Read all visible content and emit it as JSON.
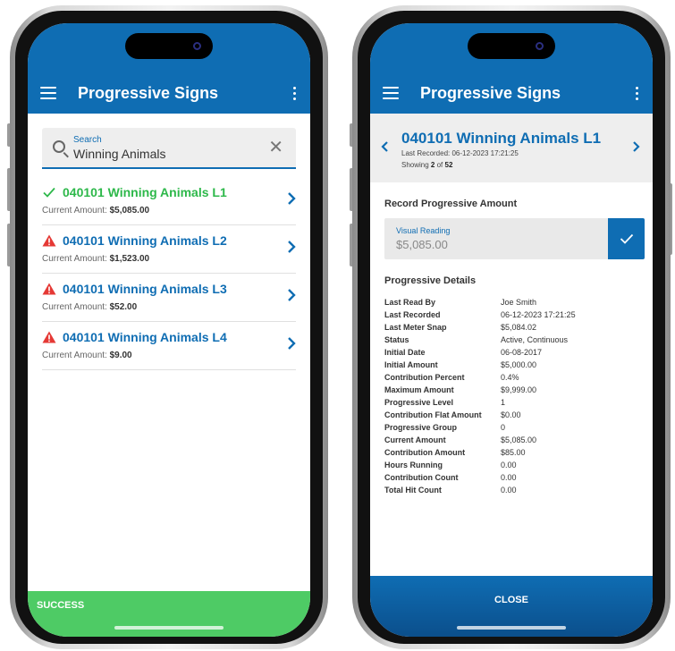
{
  "app": {
    "title": "Progressive Signs"
  },
  "colors": {
    "primary": "#0f6db3",
    "success": "#4ecb65",
    "success_text": "#2db84a",
    "warning": "#e53935"
  },
  "list_screen": {
    "search": {
      "label": "Search",
      "value": "Winning Animals"
    },
    "items": [
      {
        "title": "040101 Winning Animals L1",
        "amount_label": "Current Amount:",
        "amount": "$5,085.00",
        "status_icon": "check-icon"
      },
      {
        "title": "040101 Winning Animals L2",
        "amount_label": "Current Amount:",
        "amount": "$1,523.00",
        "status_icon": "warning-icon"
      },
      {
        "title": "040101 Winning Animals L3",
        "amount_label": "Current Amount:",
        "amount": "$52.00",
        "status_icon": "warning-icon"
      },
      {
        "title": "040101 Winning Animals L4",
        "amount_label": "Current Amount:",
        "amount": "$9.00",
        "status_icon": "warning-icon"
      }
    ],
    "footer": "SUCCESS"
  },
  "detail_screen": {
    "header": {
      "title": "040101 Winning Animals L1",
      "last_recorded": "Last Recorded: 06-12-2023 17:21:25",
      "showing_prefix": "Showing",
      "showing_index": "2",
      "showing_of": "of",
      "showing_total": "52"
    },
    "record_title": "Record Progressive Amount",
    "visual_reading": {
      "label": "Visual Reading",
      "value": "$5,085.00"
    },
    "details_title": "Progressive Details",
    "details": [
      {
        "key": "Last Read By",
        "value": "Joe Smith"
      },
      {
        "key": "Last Recorded",
        "value": "06-12-2023 17:21:25"
      },
      {
        "key": "Last Meter Snap",
        "value": "$5,084.02"
      },
      {
        "key": "Status",
        "value": "Active, Continuous"
      },
      {
        "key": "Initial Date",
        "value": "06-08-2017"
      },
      {
        "key": "Initial Amount",
        "value": "$5,000.00"
      },
      {
        "key": "Contribution Percent",
        "value": "0.4%"
      },
      {
        "key": "Maximum Amount",
        "value": "$9,999.00"
      },
      {
        "key": "Progressive Level",
        "value": "1"
      },
      {
        "key": "Contribution Flat Amount",
        "value": "$0.00"
      },
      {
        "key": "Progressive Group",
        "value": "0"
      },
      {
        "key": "Current Amount",
        "value": "$5,085.00"
      },
      {
        "key": "Contribution Amount",
        "value": "$85.00"
      },
      {
        "key": "Hours Running",
        "value": "0.00"
      },
      {
        "key": "Contribution Count",
        "value": "0.00"
      },
      {
        "key": "Total Hit Count",
        "value": "0.00"
      }
    ],
    "close_label": "CLOSE"
  }
}
